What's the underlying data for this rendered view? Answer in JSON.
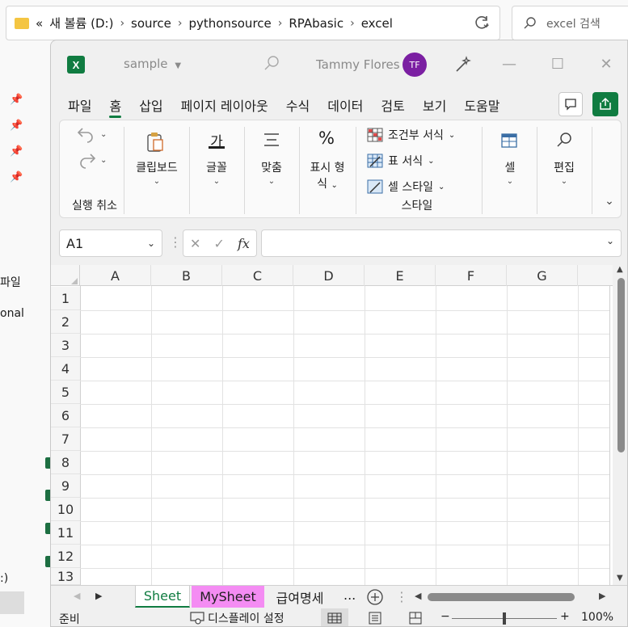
{
  "explorer": {
    "path": [
      "새 볼륨 (D:)",
      "source",
      "pythonsource",
      "RPAbasic",
      "excel"
    ],
    "back_glyph": "«",
    "search_placeholder": "excel 검색",
    "side_texts": [
      "파일",
      "onal",
      ":)"
    ]
  },
  "excel": {
    "doc_title": "sample",
    "user_name": "Tammy Flores",
    "avatar_initials": "TF",
    "accent_color": "#107c41",
    "ribbon_tabs": [
      "파일",
      "홈",
      "삽입",
      "페이지 레이아웃",
      "수식",
      "데이터",
      "검토",
      "보기",
      "도움말"
    ],
    "active_tab": "홈",
    "ribbon": {
      "undo_group": "실행 취소",
      "clipboard": "클립보드",
      "font": "글꼴",
      "align": "맞춤",
      "number_line1": "표시 형",
      "number_line2": "식",
      "cond_format": "조건부 서식",
      "table_format": "표 서식",
      "cell_style": "셀 스타일",
      "style_group": "스타일",
      "cells": "셀",
      "editing": "편집",
      "font_glyph": "가",
      "percent_glyph": "%"
    },
    "name_box": "A1",
    "fx_label": "fx",
    "columns": [
      "A",
      "B",
      "C",
      "D",
      "E",
      "F",
      "G"
    ],
    "rows": [
      "1",
      "2",
      "3",
      "4",
      "5",
      "6",
      "7",
      "8",
      "9",
      "10",
      "11",
      "12",
      "13"
    ],
    "sheets": [
      {
        "name": "Sheet",
        "active": true
      },
      {
        "name": "MySheet",
        "color": "#f48cf3"
      },
      {
        "name": "급여명세"
      }
    ],
    "more_sheets": "...",
    "status": {
      "ready": "준비",
      "display_settings": "디스플레이 설정",
      "zoom": "100%",
      "zoom_minus": "−",
      "zoom_plus": "+"
    }
  }
}
